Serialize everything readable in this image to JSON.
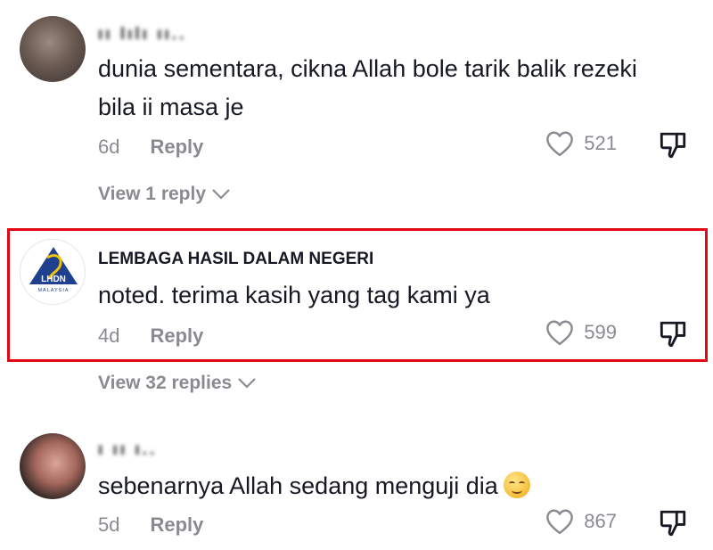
{
  "comments": [
    {
      "username": "ıı lılı ıı..",
      "text": "dunia sementara, cikna Allah bole tarik balik rezeki bila ii masa je",
      "time": "6d",
      "reply_label": "Reply",
      "likes": "521",
      "view_replies": "View 1 reply"
    },
    {
      "username": "LEMBAGA HASIL DALAM NEGERI",
      "avatar_logo_text": "LHDN",
      "avatar_logo_subtext": "MALAYSIA",
      "text": "noted. terima kasih yang tag kami ya",
      "time": "4d",
      "reply_label": "Reply",
      "likes": "599",
      "view_replies": "View 32 replies"
    },
    {
      "username": "ı ıı ı..",
      "text": "sebenarnya Allah sedang menguji dia",
      "time": "5d",
      "reply_label": "Reply",
      "likes": "867"
    }
  ],
  "colors": {
    "highlight_border": "#e30613",
    "muted_text": "#8a8b91",
    "primary_text": "#161823"
  }
}
